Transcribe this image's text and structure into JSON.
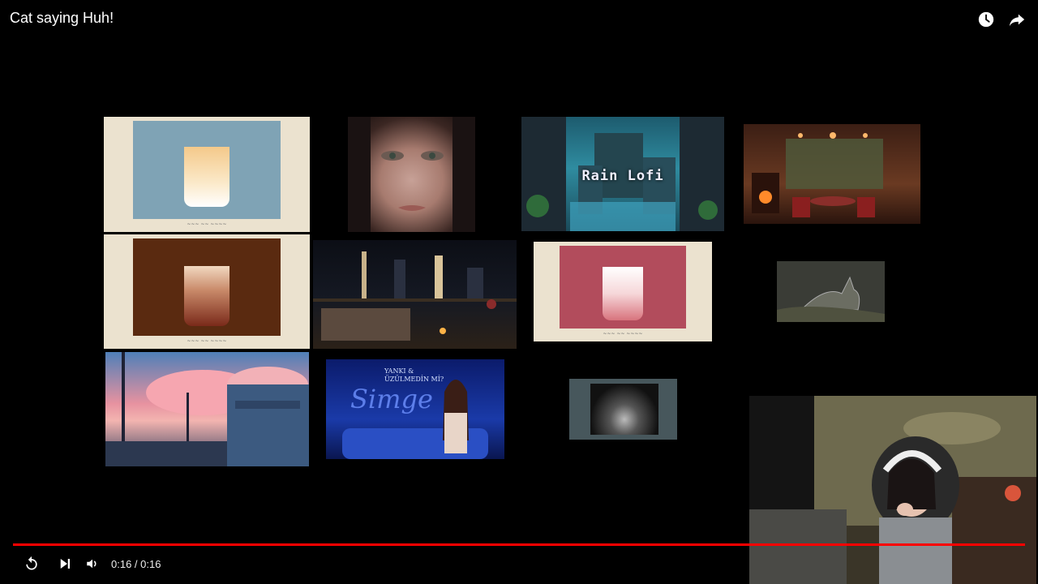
{
  "video": {
    "title": "Cat saying Huh!",
    "icons": [
      "watch-later-icon",
      "share-icon"
    ]
  },
  "thumbnails": {
    "rain_lofi_label": "Rain Lofi",
    "singer_line1": "YANKI &",
    "singer_line2": "ÜZÜLMEDİN Mİ?",
    "singer_script": "Simge"
  },
  "player": {
    "current_time": "0:16",
    "separator": " / ",
    "duration": "0:16",
    "progress": 1.0,
    "accent_color": "#ff0000",
    "icons": [
      "replay-icon",
      "next-icon",
      "volume-icon"
    ]
  }
}
